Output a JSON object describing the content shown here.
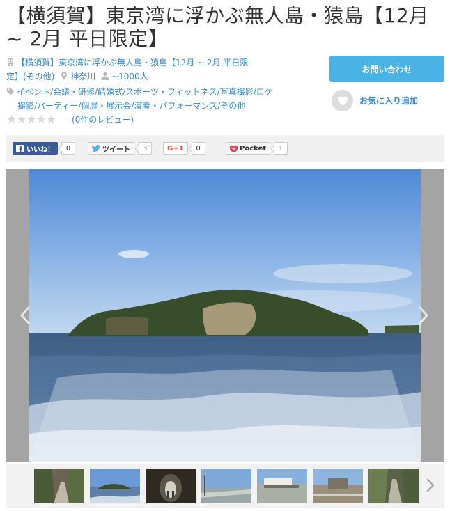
{
  "title": "【横須賀】東京湾に浮かぶ無人島・猿島【12月 ~ 2月 平日限定】",
  "venue": {
    "name_line1": "【横須賀】東京湾に浮かぶ無人島・猿島【12月 ~ 2月 平日限",
    "name_line2": "定】(その他)",
    "location": "神奈川",
    "capacity": "~1000人"
  },
  "categories": {
    "line1": "イベント/会議・研修/結婚式/スポーツ・フィットネス/写真撮影/ロケ",
    "line2": "撮影/パーティー/個展・展示会/演奏・パフォーマンス/その他"
  },
  "rating": {
    "stars": "★★★★★",
    "reviews": "(0件のレビュー)"
  },
  "actions": {
    "contact": "お問い合わせ",
    "favorite": "お気に入り追加"
  },
  "social": {
    "facebook": {
      "label": "いいね！",
      "count": "0"
    },
    "twitter": {
      "label": "ツイート",
      "count": "3"
    },
    "gplus": {
      "label": "G+1",
      "count": "0"
    },
    "pocket": {
      "label": "Pocket",
      "count": "1"
    }
  },
  "colors": {
    "link": "#3a8fd6",
    "button": "#4ab3e6",
    "facebook": "#3b5998"
  },
  "icons": [
    "building-icon",
    "pin-icon",
    "person-icon",
    "tag-icon",
    "heart-icon",
    "chevron-left-icon",
    "chevron-right-icon"
  ]
}
